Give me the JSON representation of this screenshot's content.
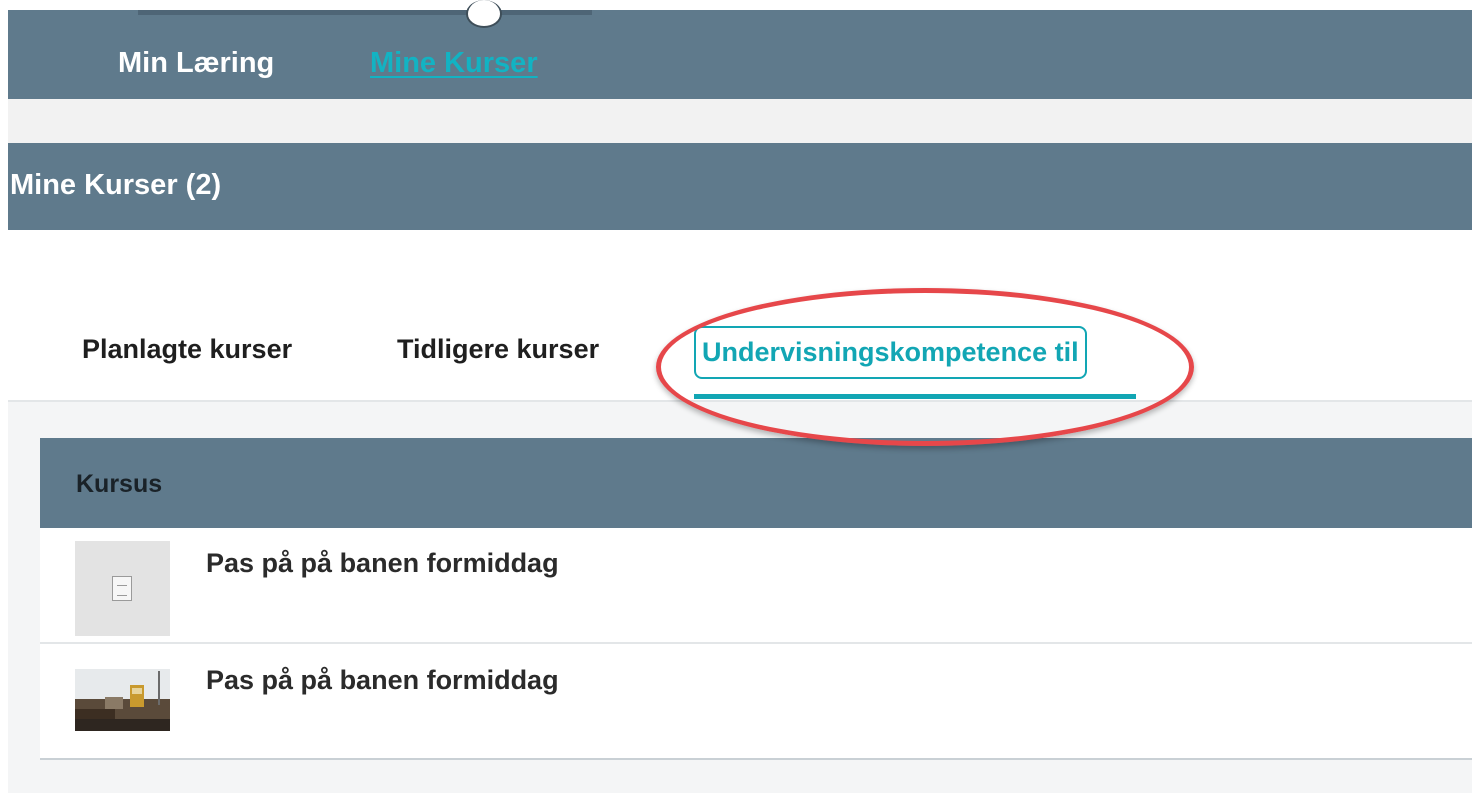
{
  "top_nav": {
    "items": [
      {
        "label": "Min Læring"
      },
      {
        "label": "Mine Kurser"
      }
    ]
  },
  "section": {
    "title": "Mine Kurser (2)"
  },
  "tabs": [
    {
      "label": "Planlagte kurser"
    },
    {
      "label": "Tidligere kurser"
    },
    {
      "label": "Undervisningskompetence til",
      "active": true
    }
  ],
  "table": {
    "column_header": "Kursus",
    "rows": [
      {
        "title": "Pas på på banen formiddag",
        "thumbnail": "document-placeholder-icon"
      },
      {
        "title": "Pas på på banen formiddag",
        "thumbnail": "course-photo"
      }
    ]
  },
  "colors": {
    "header_bg": "#5f7a8c",
    "accent_teal": "#12a6b4",
    "annotation_red": "#e6474a"
  }
}
